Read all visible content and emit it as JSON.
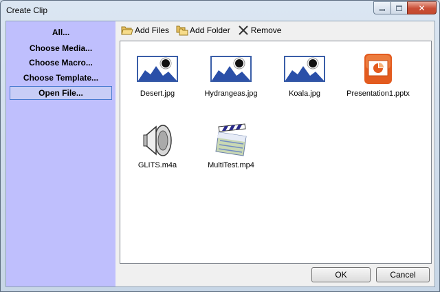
{
  "window": {
    "title": "Create Clip"
  },
  "sidebar": {
    "items": [
      {
        "label": "All...",
        "selected": false
      },
      {
        "label": "Choose Media...",
        "selected": false
      },
      {
        "label": "Choose Macro...",
        "selected": false
      },
      {
        "label": "Choose Template...",
        "selected": false
      },
      {
        "label": "Open File...",
        "selected": true
      }
    ]
  },
  "toolbar": {
    "add_files": {
      "label": "Add Files",
      "icon": "folder-open-icon"
    },
    "add_folder": {
      "label": "Add Folder",
      "icon": "folders-icon"
    },
    "remove": {
      "label": "Remove",
      "icon": "x-icon"
    }
  },
  "files": [
    {
      "name": "Desert.jpg",
      "icon": "image-thumbnail-icon"
    },
    {
      "name": "Hydrangeas.jpg",
      "icon": "image-thumbnail-icon"
    },
    {
      "name": "Koala.jpg",
      "icon": "image-thumbnail-icon"
    },
    {
      "name": "Presentation1.pptx",
      "icon": "powerpoint-icon"
    },
    {
      "name": "GLITS.m4a",
      "icon": "speaker-icon"
    },
    {
      "name": "MultiTest.mp4",
      "icon": "clapperboard-icon"
    }
  ],
  "buttons": {
    "ok": "OK",
    "cancel": "Cancel"
  },
  "colors": {
    "sidebar_bg": "#bfbffd",
    "selection_border": "#4a7bd0",
    "close_button": "#c94e36"
  }
}
